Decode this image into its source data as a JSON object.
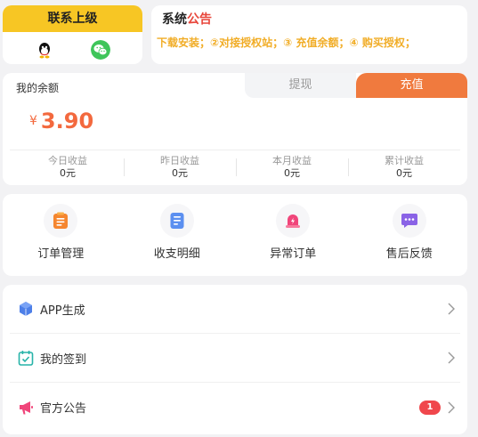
{
  "contact": {
    "header_label": "联系上级",
    "icons": [
      "qq-icon",
      "wechat-icon"
    ]
  },
  "notice": {
    "title_black": "系统",
    "title_red": "公告",
    "marquee": "下载安装；②对接授权站；③ 充值余额；④ 购买授权；"
  },
  "balance": {
    "label": "我的余额",
    "withdraw_tab": "提现",
    "recharge_tab": "充值",
    "currency": "¥",
    "amount": "3.90",
    "stats": [
      {
        "label": "今日收益",
        "value": "0元"
      },
      {
        "label": "昨日收益",
        "value": "0元"
      },
      {
        "label": "本月收益",
        "value": "0元"
      },
      {
        "label": "累计收益",
        "value": "0元"
      }
    ]
  },
  "grid": [
    {
      "label": "订单管理",
      "icon": "clipboard-icon"
    },
    {
      "label": "收支明细",
      "icon": "document-icon"
    },
    {
      "label": "异常订单",
      "icon": "alarm-icon"
    },
    {
      "label": "售后反馈",
      "icon": "chat-icon"
    }
  ],
  "menu": [
    {
      "label": "APP生成",
      "icon": "cube-icon"
    },
    {
      "label": "我的签到",
      "icon": "calendar-check-icon"
    },
    {
      "label": "官方公告",
      "icon": "megaphone-icon",
      "badge": "1"
    }
  ],
  "colors": {
    "accent_yellow": "#f7c624",
    "recharge_orange": "#f07a3e",
    "amount_orange": "#f3693e",
    "notice_text": "#f1ad27",
    "badge_red": "#f0474c"
  }
}
